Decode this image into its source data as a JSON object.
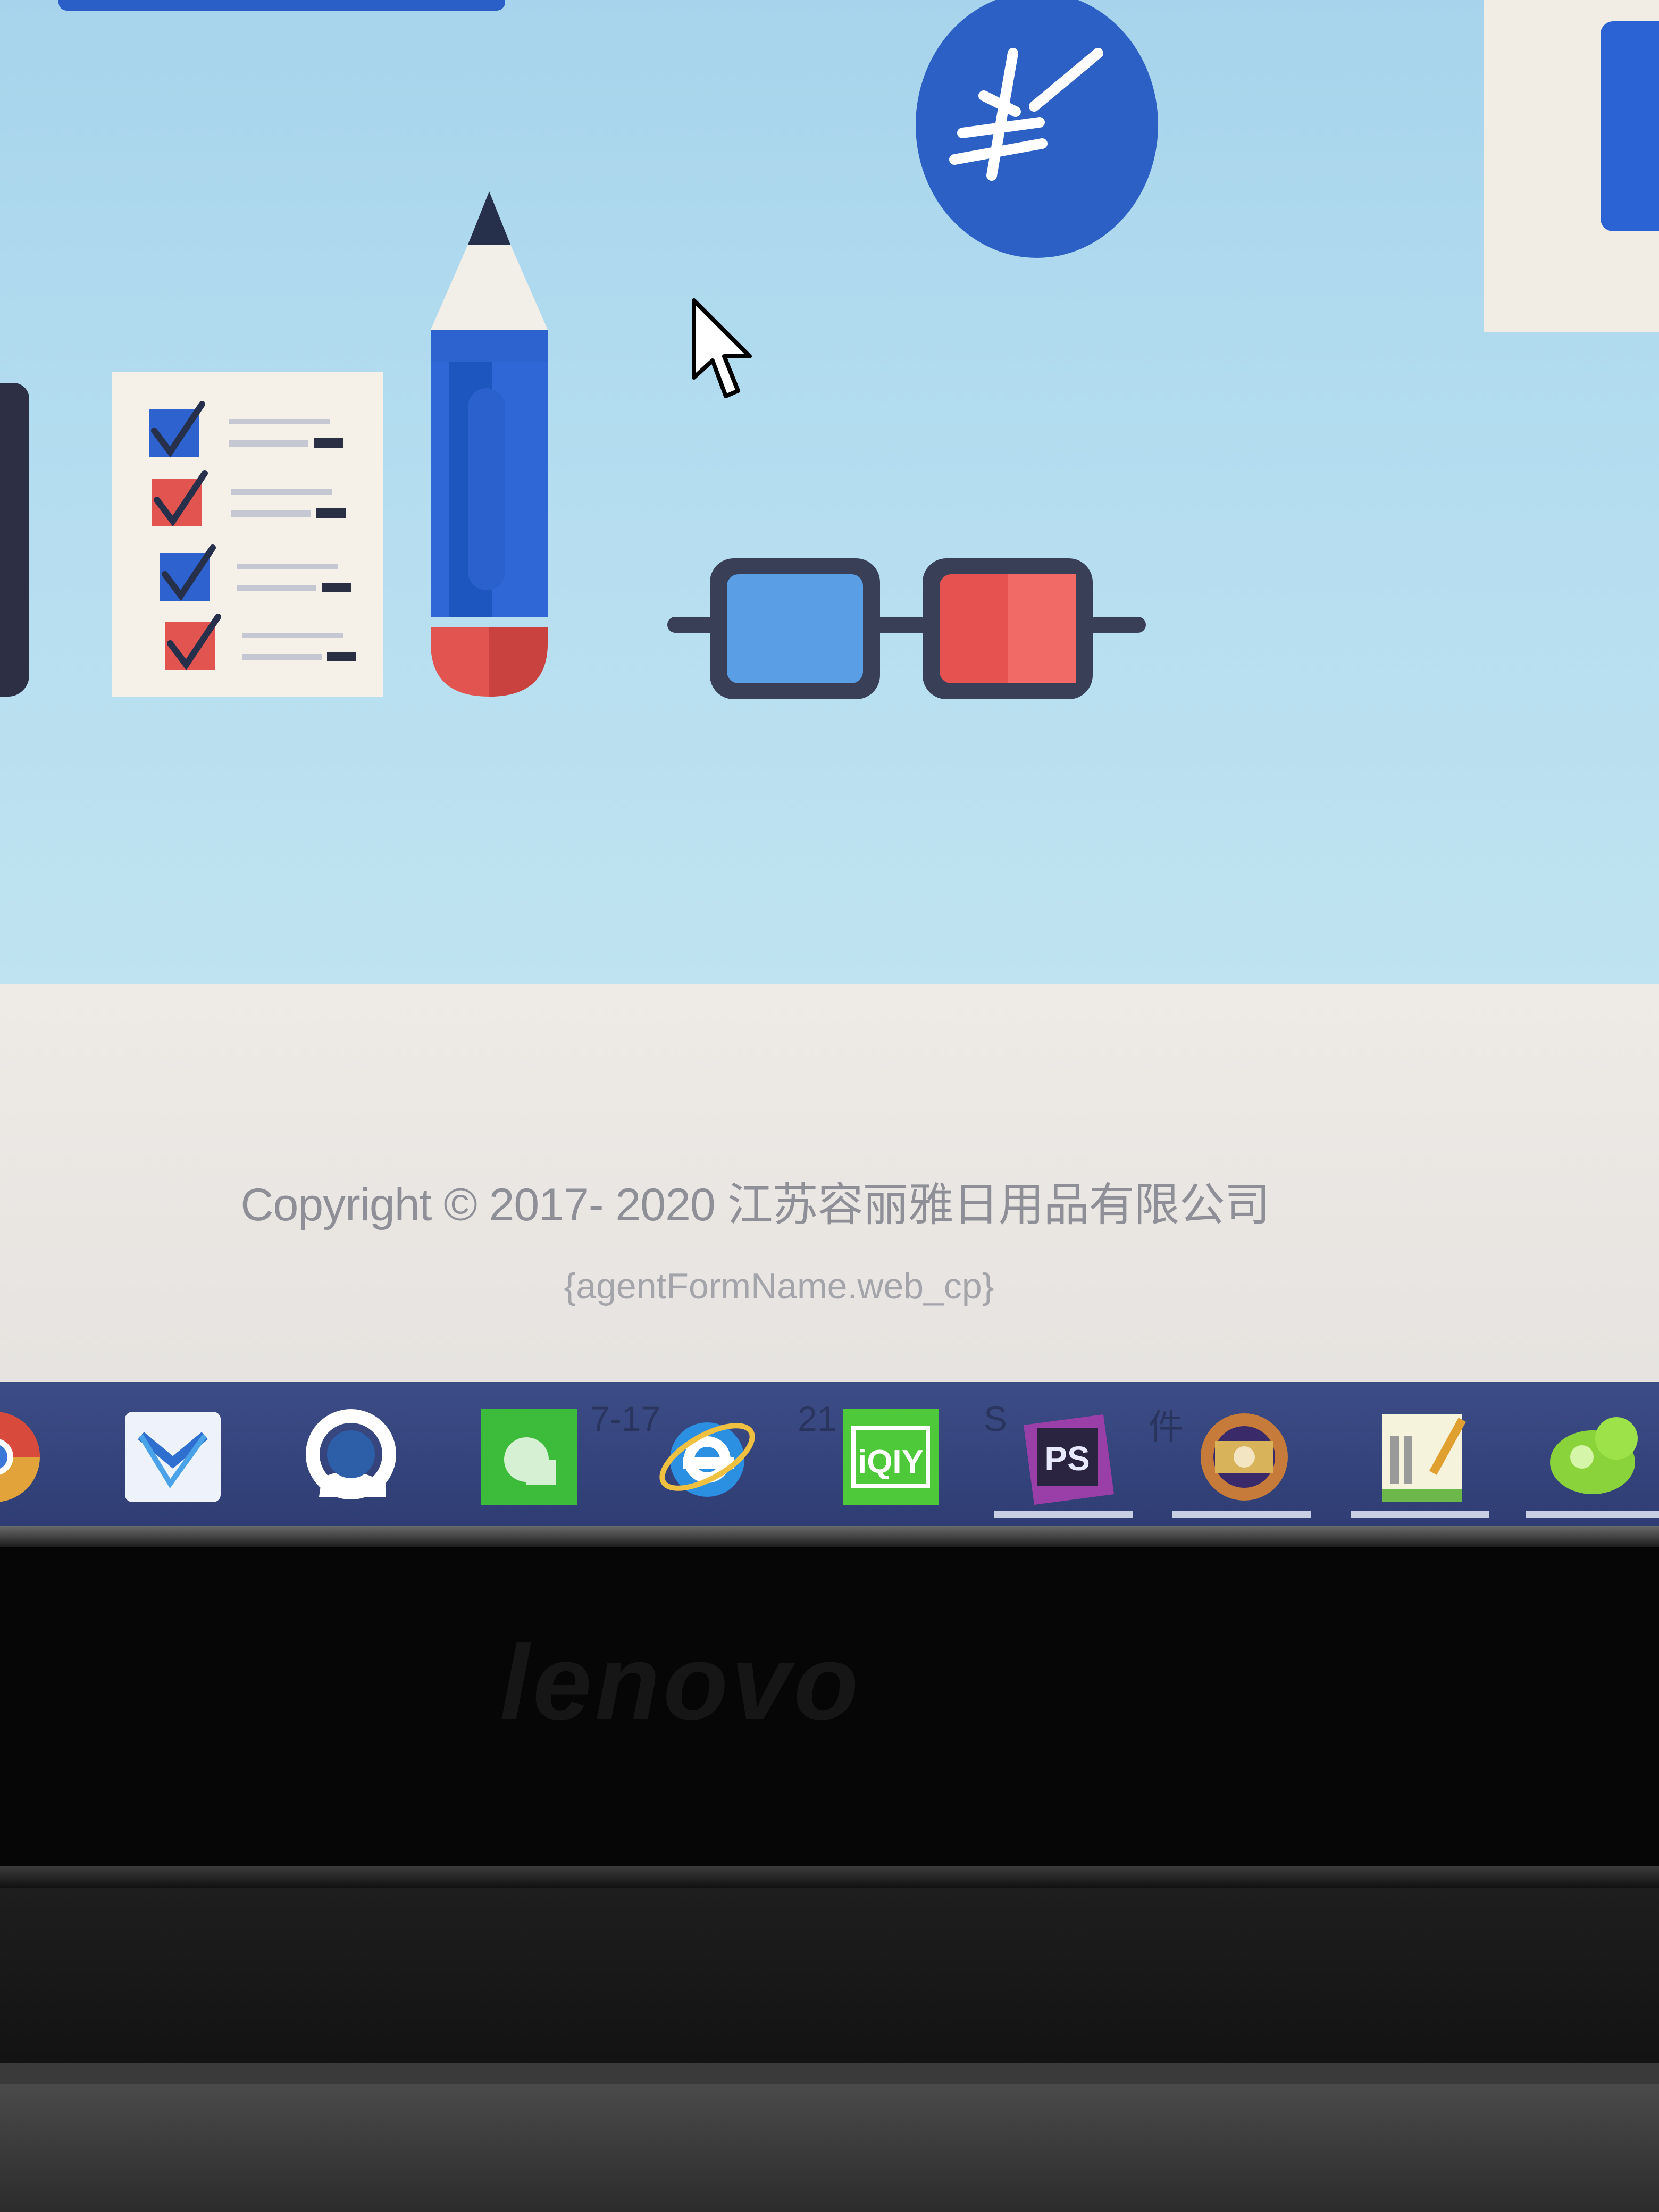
{
  "footer": {
    "copyright": "Copyright © 2017- 2020 江苏容丽雅日用品有限公司",
    "agent_form": "{agentFormName.web_cp}"
  },
  "taskbar": {
    "faded_text_1": "7-17",
    "faded_text_2": "21",
    "faded_text_3": "S",
    "faded_text_4": "件",
    "ps_label": "PS",
    "iqiyi_label": "iQIY",
    "items": [
      {
        "name": "chrome-icon"
      },
      {
        "name": "mail-app-icon"
      },
      {
        "name": "browser-q-icon"
      },
      {
        "name": "green-app-icon"
      },
      {
        "name": "internet-explorer-icon"
      },
      {
        "name": "iqiyi-icon"
      },
      {
        "name": "photoshop-icon"
      },
      {
        "name": "settings-tool-icon"
      },
      {
        "name": "notepad-icon"
      },
      {
        "name": "green-round-app-icon"
      }
    ]
  },
  "bezel": {
    "brand": "lenovo"
  },
  "colors": {
    "hero_bg": "#b6def0",
    "accent_blue": "#2b63d4",
    "accent_red": "#e65452",
    "taskbar": "#34437a",
    "footer_bg": "#eae7e3"
  }
}
